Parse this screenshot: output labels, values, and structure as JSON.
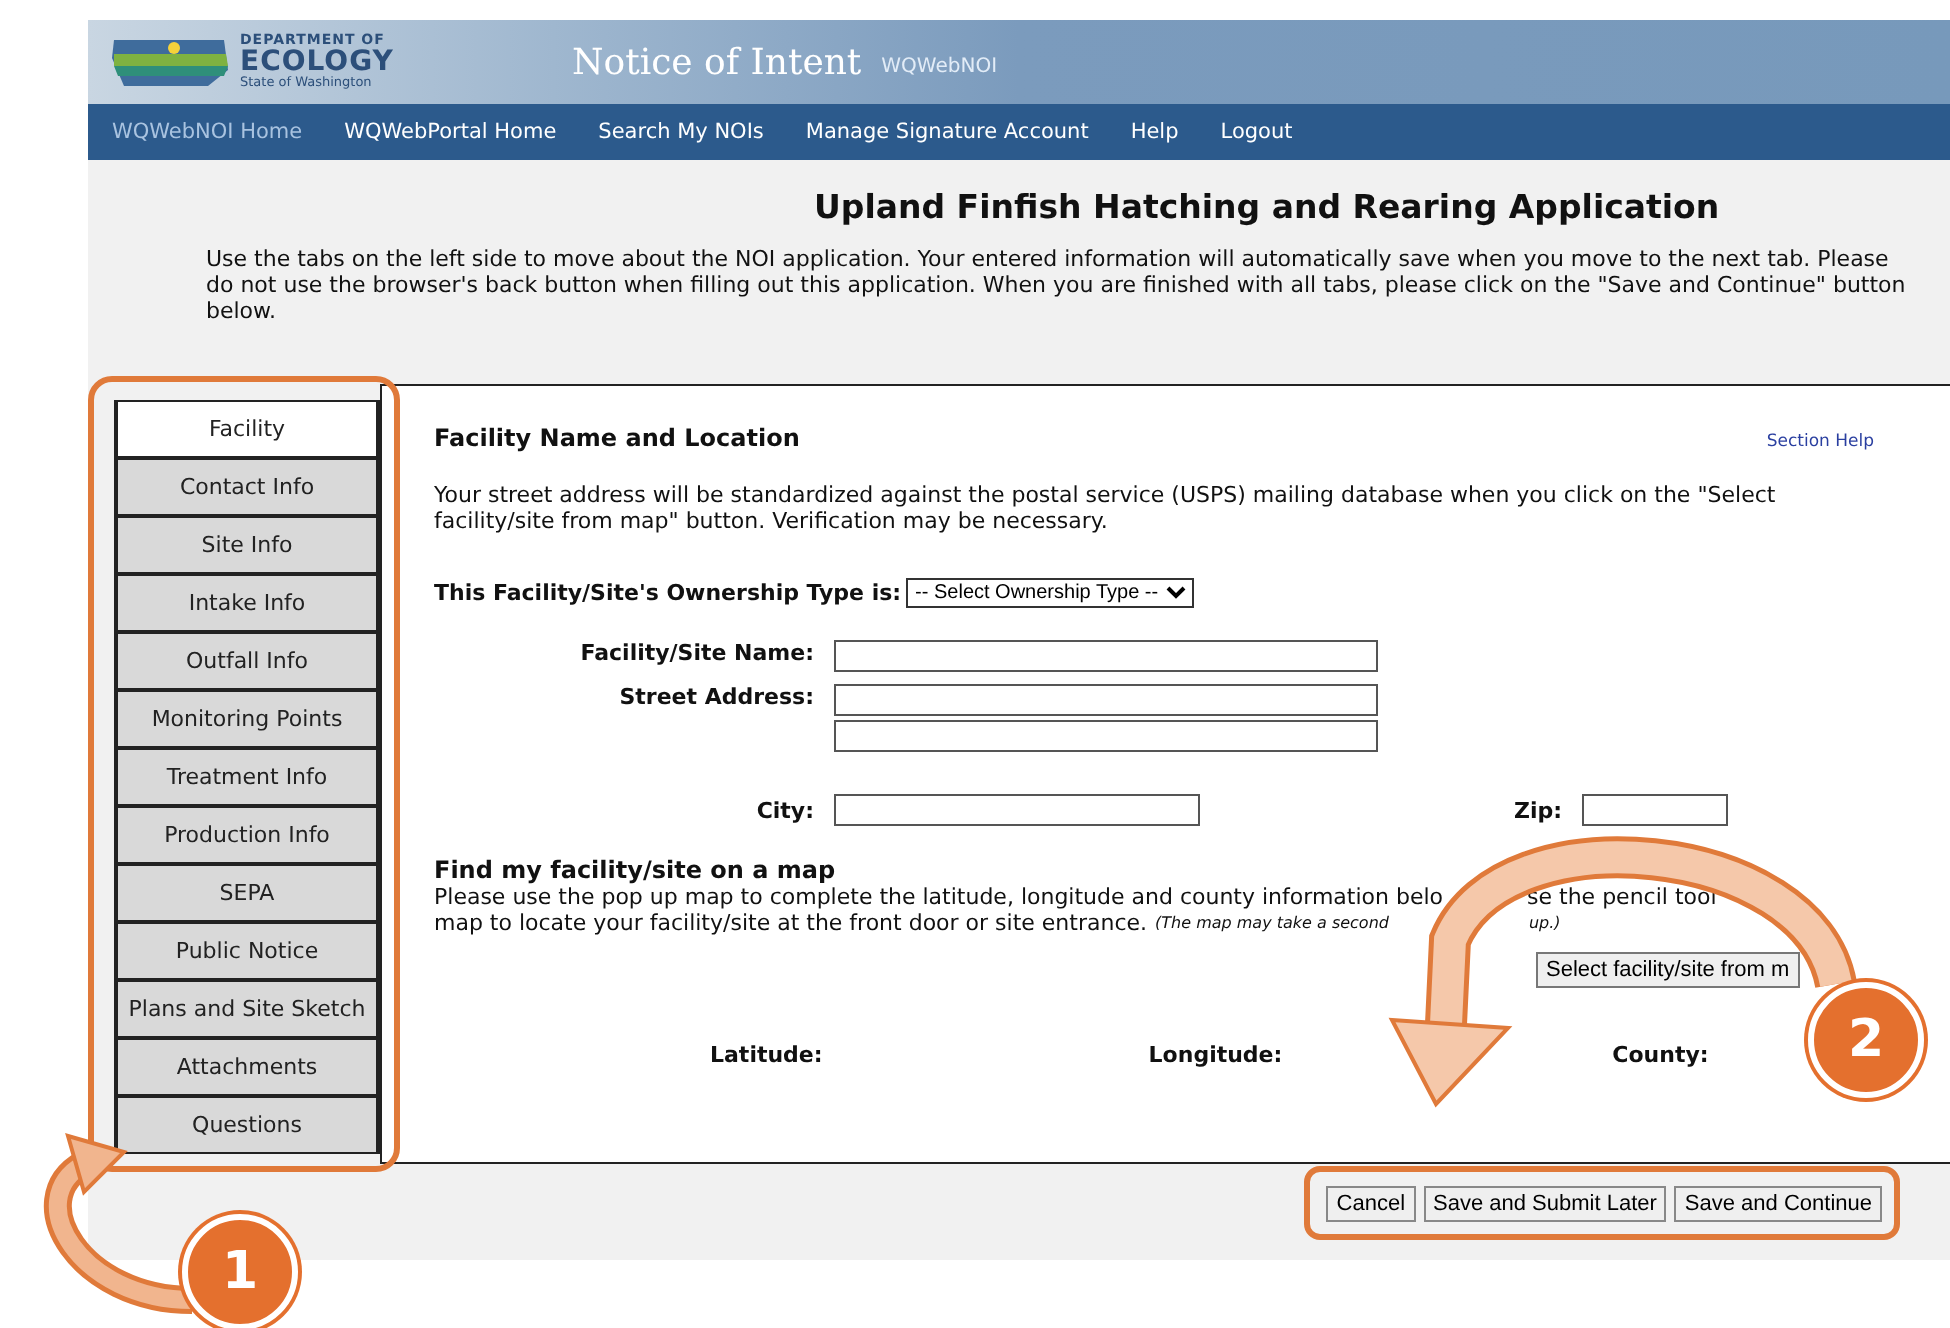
{
  "header": {
    "logo_lines": [
      "DEPARTMENT OF",
      "ECOLOGY",
      "State of Washington"
    ],
    "title": "Notice of Intent",
    "subtitle": "WQWebNOI"
  },
  "nav": [
    {
      "label": "WQWebNOI Home",
      "selected": true
    },
    {
      "label": "WQWebPortal Home",
      "selected": false
    },
    {
      "label": "Search My NOIs",
      "selected": false
    },
    {
      "label": "Manage Signature Account",
      "selected": false
    },
    {
      "label": "Help",
      "selected": false
    },
    {
      "label": "Logout",
      "selected": false
    }
  ],
  "page_title": "Upland Finfish Hatching and Rearing Application",
  "intro": "Use the tabs on the left side to move about the NOI application. Your entered information will automatically save when you move to the next tab. Please do not use the browser's back button when filling out this application. When you are finished with all tabs, please click on the \"Save and Continue\" button below.",
  "tabs": [
    {
      "label": "Facility",
      "selected": true
    },
    {
      "label": "Contact Info",
      "selected": false
    },
    {
      "label": "Site Info",
      "selected": false
    },
    {
      "label": "Intake Info",
      "selected": false
    },
    {
      "label": "Outfall Info",
      "selected": false
    },
    {
      "label": "Monitoring Points",
      "selected": false
    },
    {
      "label": "Treatment Info",
      "selected": false
    },
    {
      "label": "Production Info",
      "selected": false
    },
    {
      "label": "SEPA",
      "selected": false
    },
    {
      "label": "Public Notice",
      "selected": false
    },
    {
      "label": "Plans and Site Sketch",
      "selected": false
    },
    {
      "label": "Attachments",
      "selected": false
    },
    {
      "label": "Questions",
      "selected": false
    }
  ],
  "section": {
    "title": "Facility Name and Location",
    "help_link": "Section Help",
    "description": "Your street address will be standardized against the postal service (USPS) mailing database when you click on the \"Select facility/site from map\" button. Verification may be necessary.",
    "ownership": {
      "label": "This Facility/Site's Ownership Type is:",
      "value": "-- Select Ownership Type --"
    },
    "name_label": "Facility/Site Name:",
    "street_label": "Street Address:",
    "city_label": "City:",
    "zip_label": "Zip:",
    "map": {
      "title": "Find my facility/site on a map",
      "line1_start": "Please use the pop up map to complete the latitude, longitude and county information belo",
      "line1_end": "se the pencil tool",
      "line2": "map to locate your facility/site at the front door or site entrance.",
      "note_start": "(The map may take a second",
      "note_end": "up.)",
      "button": "Select facility/site from m"
    },
    "coords": [
      "Latitude:",
      "Longitude:",
      "County:"
    ]
  },
  "buttons": [
    "Cancel",
    "Save and Submit Later",
    "Save and Continue"
  ],
  "callouts": [
    {
      "number": "1"
    },
    {
      "number": "2"
    }
  ]
}
